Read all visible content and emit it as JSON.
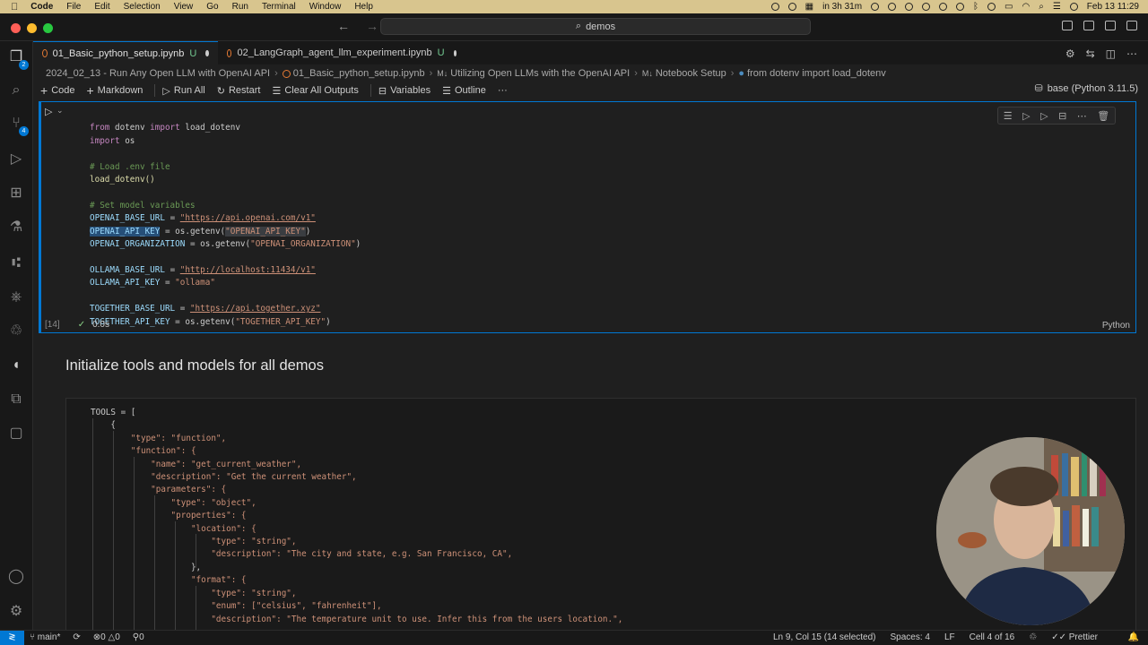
{
  "menubar": {
    "app": "Code",
    "items": [
      "File",
      "Edit",
      "Selection",
      "View",
      "Go",
      "Run",
      "Terminal",
      "Window",
      "Help"
    ],
    "reminder": "in 3h 31m",
    "clock": "Feb 13  11:29"
  },
  "titlebar": {
    "search_text": "demos"
  },
  "tabs": [
    {
      "label": "01_Basic_python_setup.ipynb",
      "status": "U"
    },
    {
      "label": "02_LangGraph_agent_llm_experiment.ipynb",
      "status": "U"
    }
  ],
  "activity_badges": {
    "explorer": "2",
    "scm": "4"
  },
  "breadcrumb": {
    "folder": "2024_02_13 - Run Any Open LLM with OpenAI API",
    "file": "01_Basic_python_setup.ipynb",
    "md_prefix": "M↓",
    "section1": "Utilizing Open LLMs with the OpenAI API",
    "section2": "Notebook Setup",
    "symbol": "from dotenv import load_dotenv"
  },
  "toolbar": {
    "code": "Code",
    "markdown": "Markdown",
    "run_all": "Run All",
    "restart": "Restart",
    "clear_outputs": "Clear All Outputs",
    "variables": "Variables",
    "outline": "Outline",
    "more": "···",
    "kernel": "base (Python 3.11.5)"
  },
  "cell1": {
    "exec_count": "[14]",
    "duration": "0.0s",
    "language": "Python",
    "lines": {
      "l1a": "from",
      "l1b": " dotenv ",
      "l1c": "import",
      "l1d": " load_dotenv",
      "l2a": "import",
      "l2b": " os",
      "l4": "# Load .env file",
      "l5": "load_dotenv()",
      "l7": "# Set model variables",
      "l8a": "OPENAI_BASE_URL",
      "l8b": " = ",
      "l8c": "\"https://api.openai.com/v1\"",
      "l9a": "OPENAI_API_KEY",
      "l9b": " = os.getenv(",
      "l9c": "\"OPENAI_API_KEY\"",
      "l9d": ")",
      "l10a": "OPENAI_ORGANIZATION",
      "l10b": " = os.getenv(",
      "l10c": "\"OPENAI_ORGANIZATION\"",
      "l10d": ")",
      "l12a": "OLLAMA_BASE_URL",
      "l12b": " = ",
      "l12c": "\"http://localhost:11434/v1\"",
      "l13a": "OLLAMA_API_KEY",
      "l13b": " = ",
      "l13c": "\"ollama\"",
      "l15a": "TOGETHER_BASE_URL",
      "l15b": " = ",
      "l15c": "\"https://api.together.xyz\"",
      "l16a": "TOGETHER_API_KEY",
      "l16b": " = os.getenv(",
      "l16c": "\"TOGETHER_API_KEY\"",
      "l16d": ")"
    }
  },
  "markdown_heading": "Initialize tools and models for all demos",
  "cell2": {
    "lines": [
      "TOOLS = [",
      "    {",
      "        \"type\": \"function\",",
      "        \"function\": {",
      "            \"name\": \"get_current_weather\",",
      "            \"description\": \"Get the current weather\",",
      "            \"parameters\": {",
      "                \"type\": \"object\",",
      "                \"properties\": {",
      "                    \"location\": {",
      "                        \"type\": \"string\",",
      "                        \"description\": \"The city and state, e.g. San Francisco, CA\",",
      "                    },",
      "                    \"format\": {",
      "                        \"type\": \"string\",",
      "                        \"enum\": [\"celsius\", \"fahrenheit\"],",
      "                        \"description\": \"The temperature unit to use. Infer this from the users location.\","
    ]
  },
  "statusbar": {
    "branch": "main*",
    "errors": "0",
    "warnings": "0",
    "ports": "0",
    "position": "Ln 9, Col 15 (14 selected)",
    "spaces": "Spaces: 4",
    "eol": "LF",
    "cell": "Cell 4 of 16",
    "formatter": "Prettier"
  }
}
